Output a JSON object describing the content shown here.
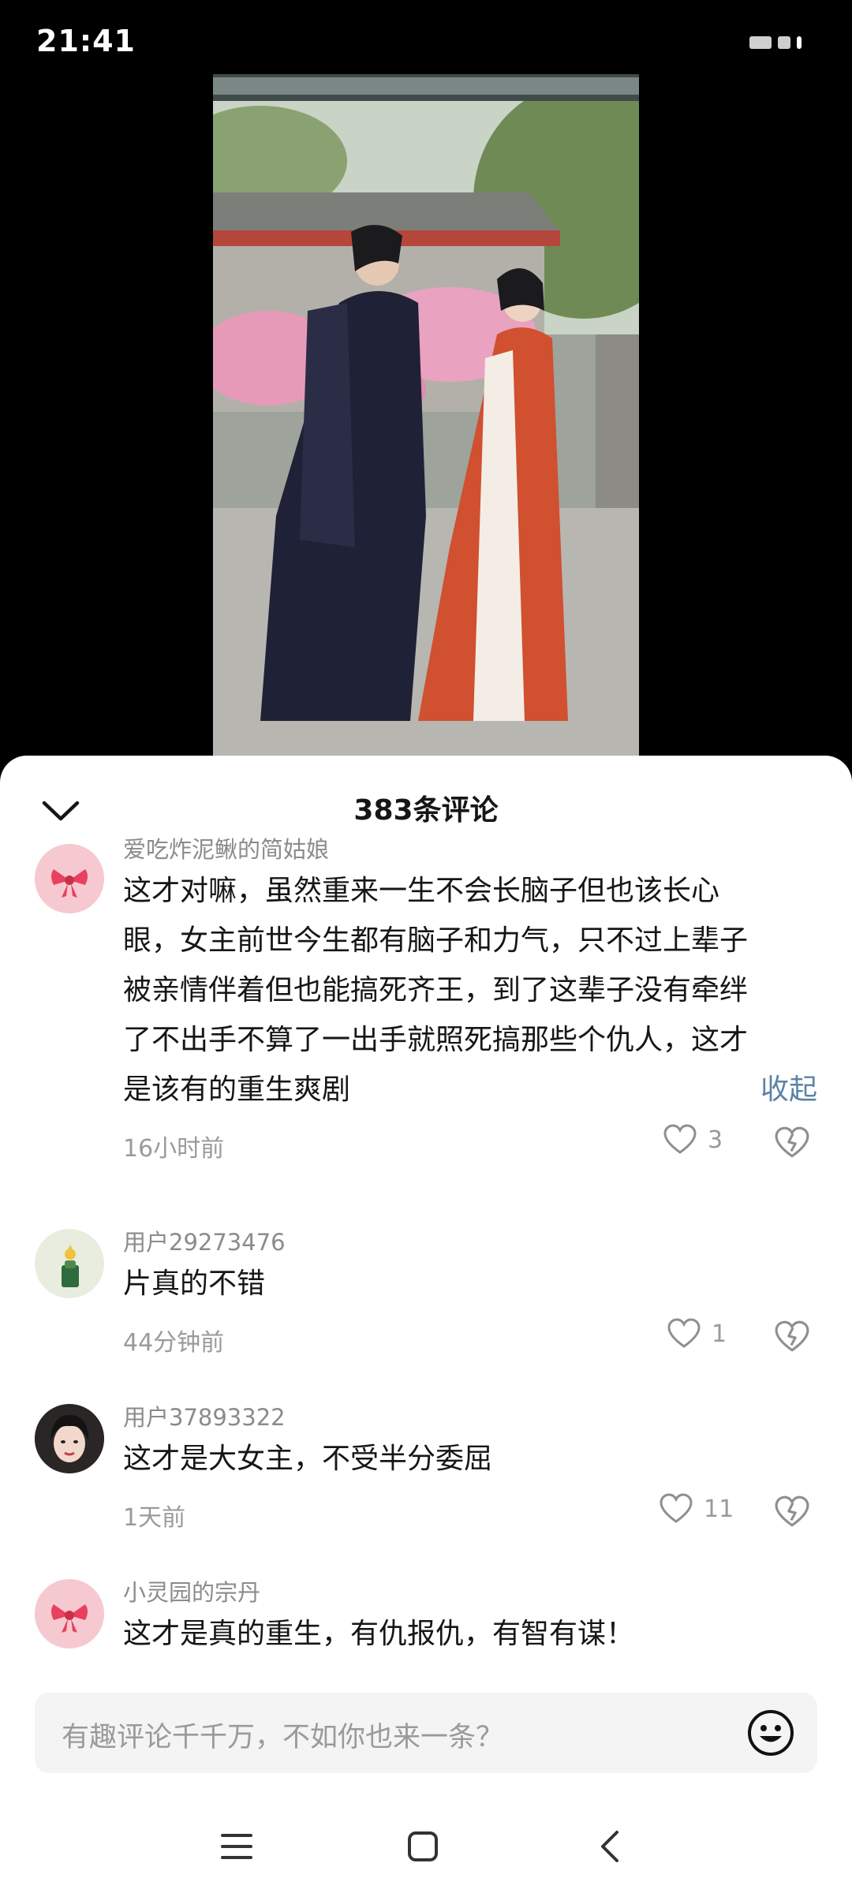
{
  "status_bar": {
    "time": "21:41"
  },
  "sheet": {
    "title": "383条评论",
    "comments": [
      {
        "author": "爱吃炸泥鳅的简姑娘",
        "text_lines": [
          "这才对嘛，虽然重来一生不会长脑子但也该长心",
          "眼，女主前世今生都有脑子和力气，只不过上辈子",
          "被亲情伴着但也能搞死齐王，到了这辈子没有牵绊",
          "了不出手不算了一出手就照死搞那些个仇人，这才",
          "是该有的重生爽剧"
        ],
        "fold_label": "收起",
        "time": "16小时前",
        "likes": "3",
        "avatar_icon": "bow-icon"
      },
      {
        "author": "用户29273476",
        "text_lines": [
          "片真的不错"
        ],
        "time": "44分钟前",
        "likes": "1",
        "avatar_icon": "cactus-icon"
      },
      {
        "author": "用户37893322",
        "text_lines": [
          "这才是大女主，不受半分委屈"
        ],
        "time": "1天前",
        "likes": "11",
        "avatar_icon": "portrait-avatar"
      },
      {
        "author": "小灵园的宗丹",
        "text_lines": [
          "这才是真的重生，有仇报仇，有智有谋！"
        ],
        "avatar_icon": "bow-icon"
      }
    ]
  },
  "input": {
    "placeholder": "有趣评论千千万，不如你也来一条？"
  },
  "colors": {
    "link": "#5b83a6",
    "sheet_bg": "#ffffff",
    "input_bg": "#f4f4f4"
  }
}
